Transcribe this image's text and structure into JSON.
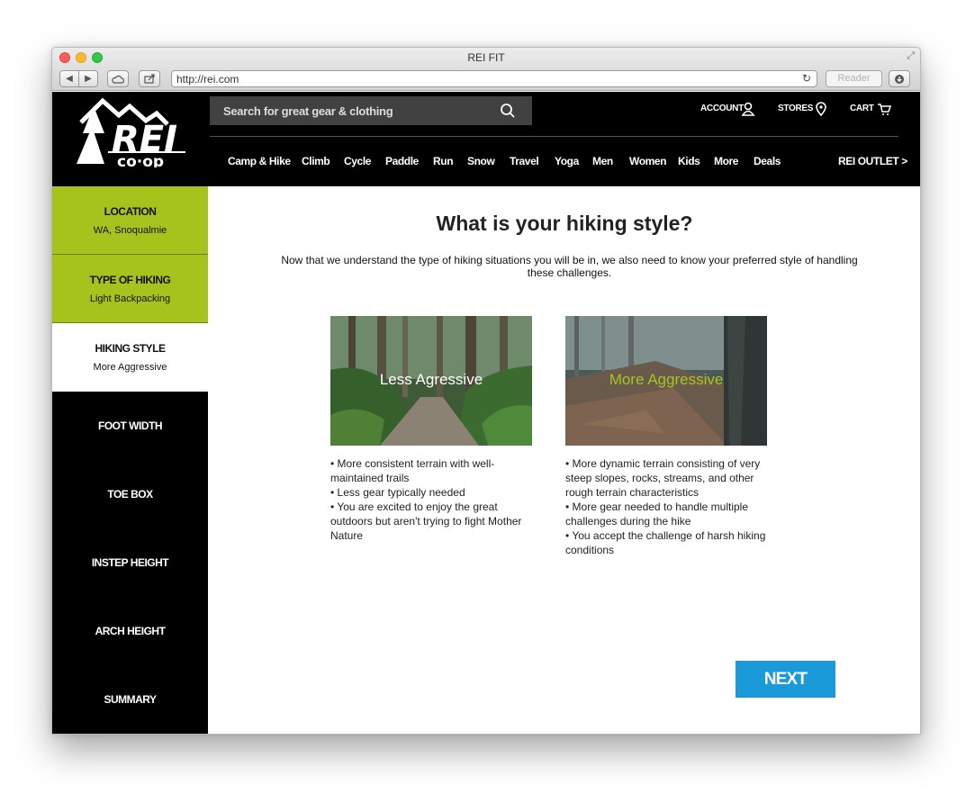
{
  "browser": {
    "title": "REI FIT",
    "url": "http://rei.com",
    "reader_label": "Reader"
  },
  "header": {
    "logo_text": "REI",
    "logo_sub": "co·op",
    "search_placeholder": "Search for great gear & clothing",
    "account_label": "ACCOUNT",
    "stores_label": "STORES",
    "cart_label": "CART",
    "nav": [
      "Camp & Hike",
      "Climb",
      "Cycle",
      "Paddle",
      "Run",
      "Snow",
      "Travel",
      "Yoga",
      "Men",
      "Women",
      "Kids",
      "More",
      "Deals"
    ],
    "outlet_label": "REI OUTLET",
    "outlet_chevron": ">"
  },
  "sidebar": {
    "steps": [
      {
        "title": "LOCATION",
        "value": "WA, Snoqualmie",
        "state": "done"
      },
      {
        "title": "TYPE OF HIKING",
        "value": "Light Backpacking",
        "state": "done"
      },
      {
        "title": "HIKING STYLE",
        "value": "More Aggressive",
        "state": "active"
      },
      {
        "title": "FOOT WIDTH",
        "value": "",
        "state": "pending"
      },
      {
        "title": "TOE BOX",
        "value": "",
        "state": "pending"
      },
      {
        "title": "INSTEP HEIGHT",
        "value": "",
        "state": "pending"
      },
      {
        "title": "ARCH HEIGHT",
        "value": "",
        "state": "pending"
      },
      {
        "title": "SUMMARY",
        "value": "",
        "state": "pending"
      }
    ]
  },
  "main": {
    "question": "What is your hiking style?",
    "intro": "Now that we understand the type of hiking situations you will be in, we also need to know your preferred style of handling these challenges.",
    "options": [
      {
        "label": "Less Agressive",
        "bullets": [
          "• More consistent terrain with well-maintained trails",
          "• Less gear typically needed",
          "• You are excited to enjoy the great outdoors but aren't trying to fight Mother Nature"
        ]
      },
      {
        "label": "More Aggressive",
        "bullets": [
          "• More dynamic terrain consisting of very steep slopes, rocks, streams, and other rough terrain characteristics",
          "• More gear needed to handle multiple challenges during the hike",
          "• You accept the challenge of harsh hiking conditions"
        ]
      }
    ],
    "next_label": "NEXT"
  },
  "colors": {
    "brand_green": "#a5c31c",
    "next_blue": "#1b9ad9",
    "header_black": "#000000"
  }
}
